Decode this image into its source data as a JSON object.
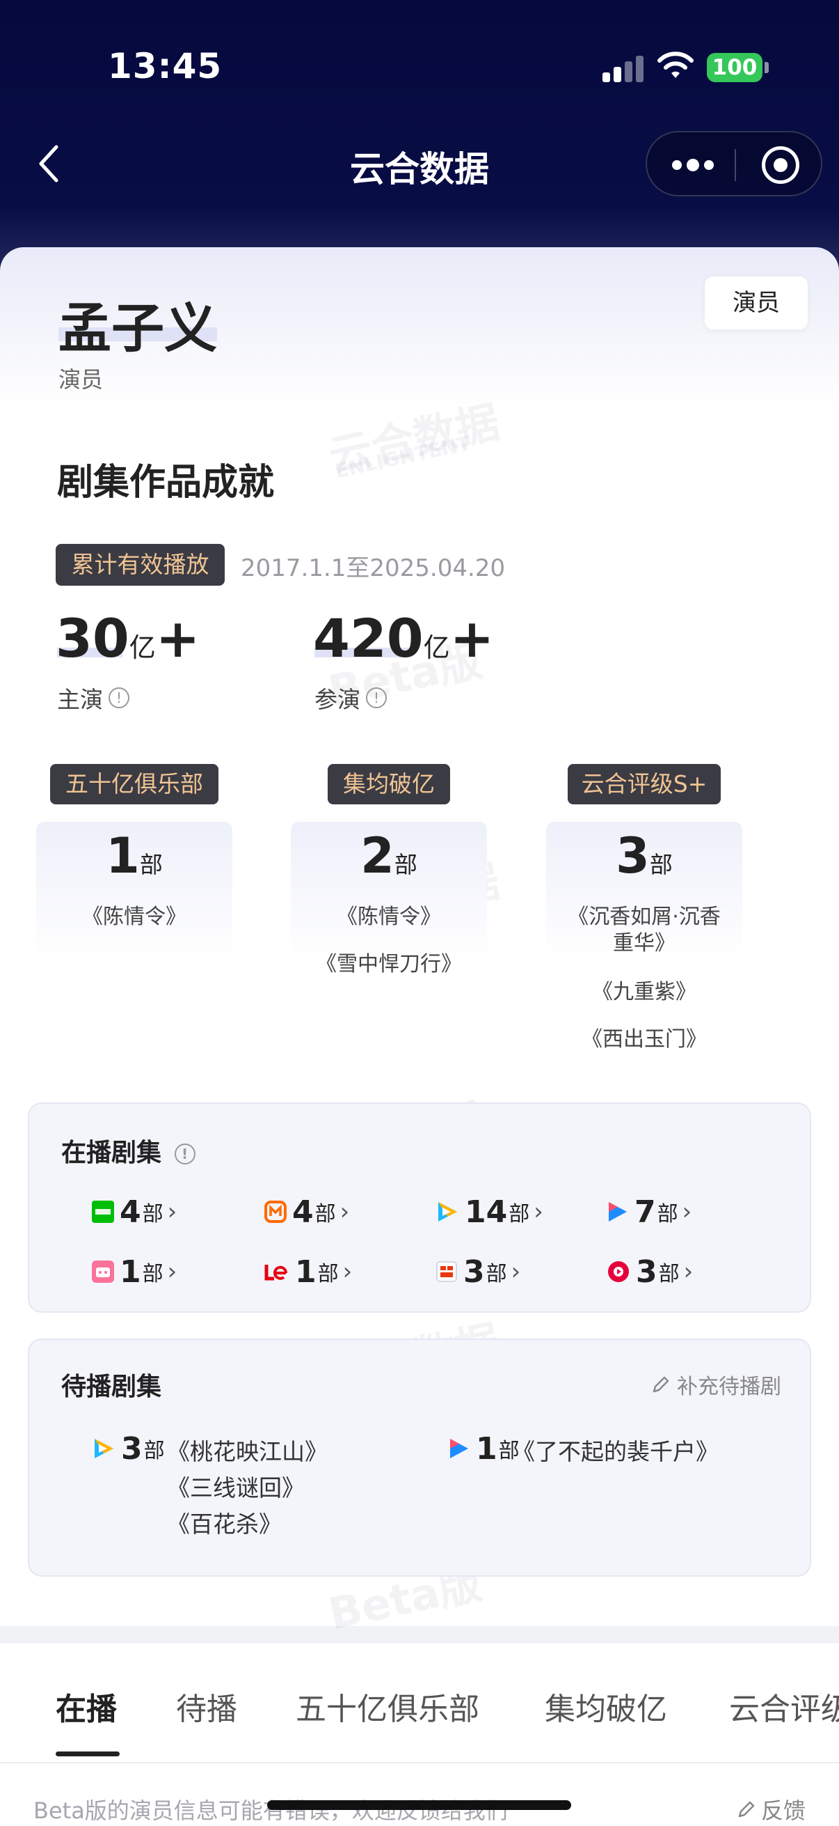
{
  "status_bar": {
    "time": "13:45",
    "battery": "100"
  },
  "nav": {
    "title": "云合数据"
  },
  "profile": {
    "name": "孟子义",
    "role": "演员",
    "tag": "演员"
  },
  "watermark": {
    "brand": "云合数据",
    "brand_en": "ENLIGHTENT",
    "beta": "Beta版"
  },
  "achievement": {
    "title": "剧集作品成就",
    "cumulative_badge": "累计有效播放",
    "date_range": "2017.1.1至2025.04.20",
    "lead": {
      "value": "30",
      "unit": "亿",
      "plus": "+",
      "label": "主演"
    },
    "support": {
      "value": "420",
      "unit": "亿",
      "plus": "+",
      "label": "参演"
    },
    "clubs": [
      {
        "badge": "五十亿俱乐部",
        "count": "1",
        "unit": "部",
        "items": [
          "《陈情令》"
        ]
      },
      {
        "badge": "集均破亿",
        "count": "2",
        "unit": "部",
        "items": [
          "《陈情令》",
          "《雪中悍刀行》"
        ]
      },
      {
        "badge": "云合评级S+",
        "count": "3",
        "unit": "部",
        "items": [
          "《沉香如屑·沉香",
          "重华》",
          "《九重紫》",
          "《西出玉门》"
        ]
      }
    ]
  },
  "airing": {
    "title": "在播剧集",
    "platforms": [
      {
        "icon": "iqiyi-icon",
        "count": "4",
        "unit": "部"
      },
      {
        "icon": "mgtv-icon",
        "count": "4",
        "unit": "部"
      },
      {
        "icon": "tencent-video-icon",
        "count": "14",
        "unit": "部"
      },
      {
        "icon": "youku-icon",
        "count": "7",
        "unit": "部"
      },
      {
        "icon": "bilibili-icon",
        "count": "1",
        "unit": "部"
      },
      {
        "icon": "letv-icon",
        "count": "1",
        "unit": "部"
      },
      {
        "icon": "sohu-video-icon",
        "count": "3",
        "unit": "部"
      },
      {
        "icon": "pptv-icon",
        "count": "3",
        "unit": "部"
      }
    ]
  },
  "pending": {
    "title": "待播剧集",
    "supplement": "补充待播剧",
    "groups": [
      {
        "icon": "tencent-video-icon",
        "count": "3",
        "unit": "部",
        "titles": [
          "《桃花映江山》",
          "《三线谜回》",
          "《百花杀》"
        ]
      },
      {
        "icon": "youku-icon",
        "count": "1",
        "unit": "部",
        "titles": [
          "《了不起的裴千户》"
        ]
      }
    ]
  },
  "tabs": [
    "在播",
    "待播",
    "五十亿俱乐部",
    "集均破亿",
    "云合评级"
  ],
  "footer": {
    "text": "Beta版的演员信息可能有错误，欢迎反馈给我们",
    "feedback": "反馈"
  },
  "colors": {
    "header_bg": "#05093d",
    "badge_bg": "#3b3b44",
    "badge_text": "#f0c493",
    "iqiyi": "#00be06",
    "mgtv": "#ff6a00",
    "youku": "#1e8cff",
    "bilibili": "#fb7299",
    "letv": "#e60012",
    "pptv": "#e4003a"
  }
}
